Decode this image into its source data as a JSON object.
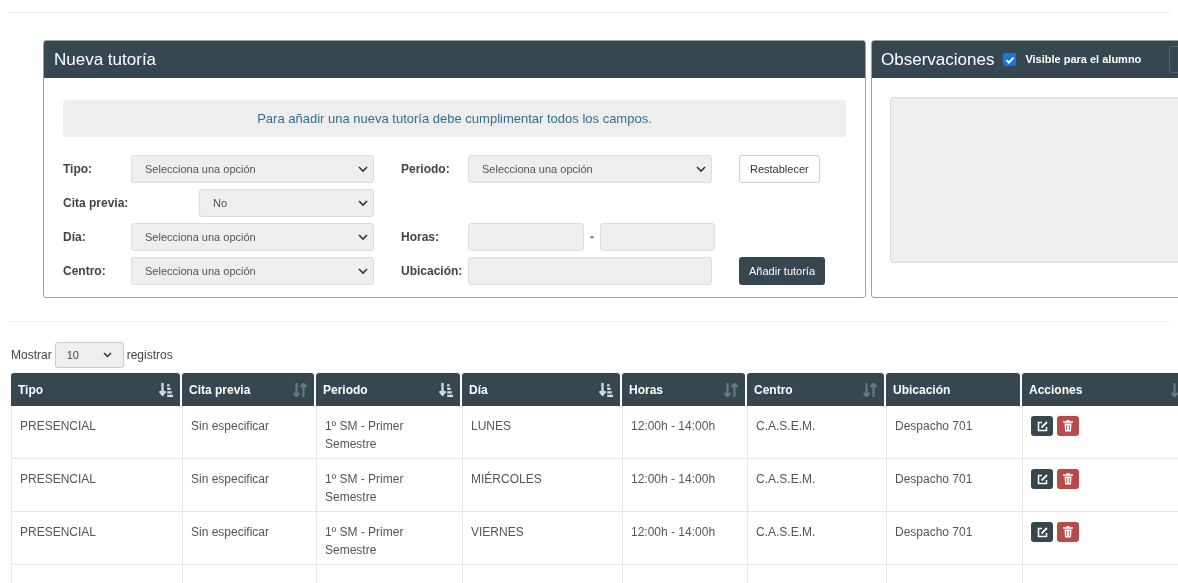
{
  "new_tutoring": {
    "title": "Nueva tutoría",
    "notice": "Para añadir una nueva tutoría debe cumplimentar todos los campos.",
    "rows": [
      {
        "left": {
          "label": "Tipo:",
          "kind": "select",
          "value": "Selecciona una opción"
        },
        "right": {
          "label": "Periodo:",
          "kind": "select",
          "value": "Selecciona una opción"
        },
        "action": {
          "label": "Restablecer",
          "kind": "outline"
        }
      },
      {
        "left": {
          "label": "Cita previa:",
          "kind": "select-short",
          "value": "No"
        }
      },
      {
        "left": {
          "label": "Día:",
          "kind": "select",
          "value": "Selecciona una opción"
        },
        "right": {
          "label": "Horas:",
          "kind": "range",
          "separator": "-"
        }
      },
      {
        "left": {
          "label": "Centro:",
          "kind": "select",
          "value": "Selecciona una opción"
        },
        "right": {
          "label": "Ubicación:",
          "kind": "input"
        },
        "action": {
          "label": "Añadir tutoría",
          "kind": "primary"
        }
      }
    ]
  },
  "observations": {
    "title": "Observaciones",
    "visible_checkbox": {
      "label": "Visible para el alumno",
      "checked": true
    }
  },
  "length_menu": {
    "before": "Mostrar",
    "value": "10",
    "after": "registros"
  },
  "table": {
    "columns": [
      {
        "label": "Tipo",
        "sortable": true,
        "sorted": true
      },
      {
        "label": "Cita previa",
        "sortable": true,
        "sorted": false
      },
      {
        "label": "Periodo",
        "sortable": true,
        "sorted": true
      },
      {
        "label": "Día",
        "sortable": true,
        "sorted": true
      },
      {
        "label": "Horas",
        "sortable": true,
        "sorted": false
      },
      {
        "label": "Centro",
        "sortable": true,
        "sorted": false
      },
      {
        "label": "Ubicación",
        "sortable": false
      },
      {
        "label": "Acciones",
        "sortable": true,
        "sorted": false
      }
    ],
    "rows": [
      [
        "PRESENCIAL",
        "Sin especificar",
        "1º SM - Primer Semestre",
        "LUNES",
        "12:00h - 14:00h",
        "C.A.S.E.M.",
        "Despacho 701"
      ],
      [
        "PRESENCIAL",
        "Sin especificar",
        "1º SM - Primer Semestre",
        "MIÉRCOLES",
        "12:00h - 14:00h",
        "C.A.S.E.M.",
        "Despacho 701"
      ],
      [
        "PRESENCIAL",
        "Sin especificar",
        "1º SM - Primer Semestre",
        "VIERNES",
        "12:00h - 14:00h",
        "C.A.S.E.M.",
        "Despacho 701"
      ]
    ]
  }
}
